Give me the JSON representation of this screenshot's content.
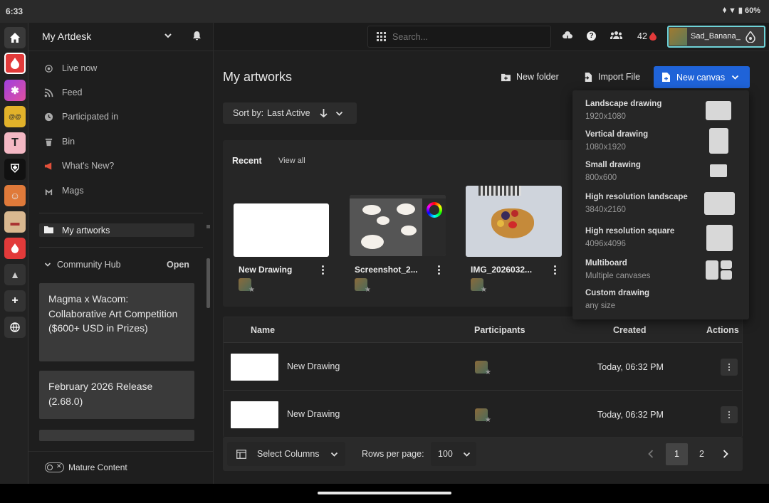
{
  "status": {
    "time": "6:33",
    "battery": "60%"
  },
  "sidebar": {
    "workspace": "My Artdesk",
    "nav": [
      {
        "label": "Live now",
        "icon": "live-icon"
      },
      {
        "label": "Feed",
        "icon": "rss-icon"
      },
      {
        "label": "Participated in",
        "icon": "clock-icon"
      },
      {
        "label": "Bin",
        "icon": "trash-icon"
      },
      {
        "label": "What's New?",
        "icon": "megaphone-icon"
      },
      {
        "label": "Mags",
        "icon": "mags-icon"
      }
    ],
    "selected": {
      "label": "My artworks",
      "icon": "folder-icon"
    },
    "community": {
      "label": "Community Hub",
      "action": "Open"
    },
    "hub_cards": [
      "Magma x Wacom: Collaborative Art Competition ($600+ USD in Prizes)",
      "February 2026 Release (2.68.0)"
    ],
    "mature": "Mature Content"
  },
  "topbar": {
    "search_placeholder": "Search...",
    "points": "42",
    "username": "Sad_Banana_"
  },
  "main": {
    "title": "My artworks",
    "new_folder": "New folder",
    "import_file": "Import File",
    "new_canvas": "New canvas",
    "sort_label": "Sort by:",
    "sort_value": "Last Active",
    "recent": "Recent",
    "view_all": "View all",
    "cards": [
      {
        "title": "New Drawing"
      },
      {
        "title": "Screenshot_2..."
      },
      {
        "title": "IMG_2026032..."
      }
    ],
    "table": {
      "headers": {
        "name": "Name",
        "participants": "Participants",
        "created": "Created",
        "actions": "Actions"
      },
      "rows": [
        {
          "name": "New Drawing",
          "created": "Today, 06:32 PM"
        },
        {
          "name": "New Drawing",
          "created": "Today, 06:32 PM"
        }
      ]
    },
    "footer": {
      "select_columns": "Select Columns",
      "rows_per_page": "Rows per page:",
      "rows_value": "100",
      "pages": [
        "1",
        "2"
      ]
    }
  },
  "dropdown": [
    {
      "name": "Landscape drawing",
      "sub": "1920x1080"
    },
    {
      "name": "Vertical drawing",
      "sub": "1080x1920"
    },
    {
      "name": "Small drawing",
      "sub": "800x600"
    },
    {
      "name": "High resolution landscape",
      "sub": "3840x2160"
    },
    {
      "name": "High resolution square",
      "sub": "4096x4096"
    },
    {
      "name": "Multiboard",
      "sub": "Multiple canvases"
    },
    {
      "name": "Custom drawing",
      "sub": "any size"
    }
  ],
  "colors": {
    "accent": "#1f63d8",
    "brand_red": "#e23a3a"
  }
}
